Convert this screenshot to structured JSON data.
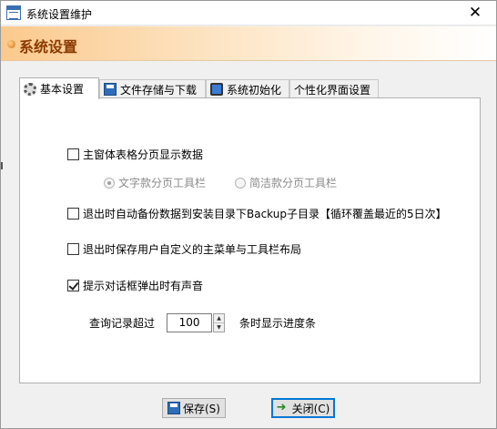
{
  "window": {
    "title": "系统设置维护",
    "close_symbol": "✕"
  },
  "banner": {
    "title": "系统设置"
  },
  "tabs": [
    {
      "label": "基本设置",
      "icon": "gear-icon",
      "active": true
    },
    {
      "label": "文件存储与下载",
      "icon": "floppy-icon",
      "active": false
    },
    {
      "label": "系统初始化",
      "icon": "monitor-icon",
      "active": false
    },
    {
      "label": "个性化界面设置",
      "icon": "",
      "active": false
    }
  ],
  "options": {
    "paginate": {
      "label": "主窗体表格分页显示数据",
      "checked": false
    },
    "radio_text": {
      "label": "文字款分页工具栏",
      "checked": true
    },
    "radio_simple": {
      "label": "简洁款分页工具栏",
      "checked": false
    },
    "backup": {
      "label": "退出时自动备份数据到安装目录下Backup子目录【循环覆盖最近的5日次】",
      "checked": false
    },
    "save_layout": {
      "label": "退出时保存用户自定义的主菜单与工具栏布局",
      "checked": false
    },
    "sound": {
      "label": "提示对话框弹出时有声音",
      "checked": true
    }
  },
  "progress": {
    "prefix": "查询记录超过",
    "value": "100",
    "suffix": "条时显示进度条",
    "spin_up": "▲",
    "spin_down": "▼"
  },
  "buttons": {
    "save": "保存(S)",
    "close": "关闭(C)"
  }
}
